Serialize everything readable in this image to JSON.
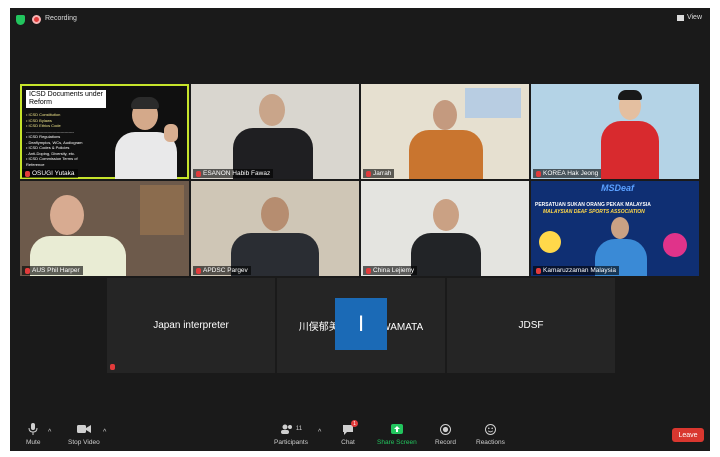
{
  "topbar": {
    "recording_label": "Recording",
    "view_label": "View"
  },
  "slide": {
    "title": "ICSD Documents under Reform",
    "items": [
      "• ICSD Constitution",
      "• ICSD Bylaws",
      "• ICSD Ethics Code",
      "------------------------------------",
      "• ICSD Regulations",
      "   - Deaflympics, WCs, Audiogram",
      "• ICSD Codes & Policies",
      "   - Anti-Doping, Diversity, etc.",
      "• ICSD Commission Terms of",
      "   Reference"
    ]
  },
  "participants": [
    {
      "name": "OSUGI Yutaka"
    },
    {
      "name": "ESANON Habib Fawaz"
    },
    {
      "name": "Jarrah"
    },
    {
      "name": "KOREA Hak Jeong"
    },
    {
      "name": "AUS Phil Harper"
    },
    {
      "name": "APDSC Pargev"
    },
    {
      "name": "China Lejiemy"
    },
    {
      "name": "Kamaruzzaman Malaysia"
    }
  ],
  "malaysia_banner": {
    "logo": "MSDeaf",
    "line1": "PERSATUAN SUKAN ORANG PEKAK MALAYSIA",
    "line2": "MALAYSIAN DEAF SPORTS ASSOCIATION"
  },
  "bottom_tiles": [
    {
      "label": "Japan interpreter"
    },
    {
      "avatar_letter": "I",
      "label": "川俣郁美 Ikumi KAWAMATA"
    },
    {
      "label": "JDSF"
    }
  ],
  "toolbar": {
    "mute": "Mute",
    "stop_video": "Stop Video",
    "participants": "Participants",
    "participants_count": "11",
    "chat": "Chat",
    "chat_badge": "1",
    "share_screen": "Share Screen",
    "record": "Record",
    "reactions": "Reactions",
    "leave": "Leave"
  },
  "colors": {
    "leave": "#d9372f",
    "share": "#22c55e",
    "active_speaker": "#c6e42b",
    "avatar": "#1b6ab6"
  }
}
